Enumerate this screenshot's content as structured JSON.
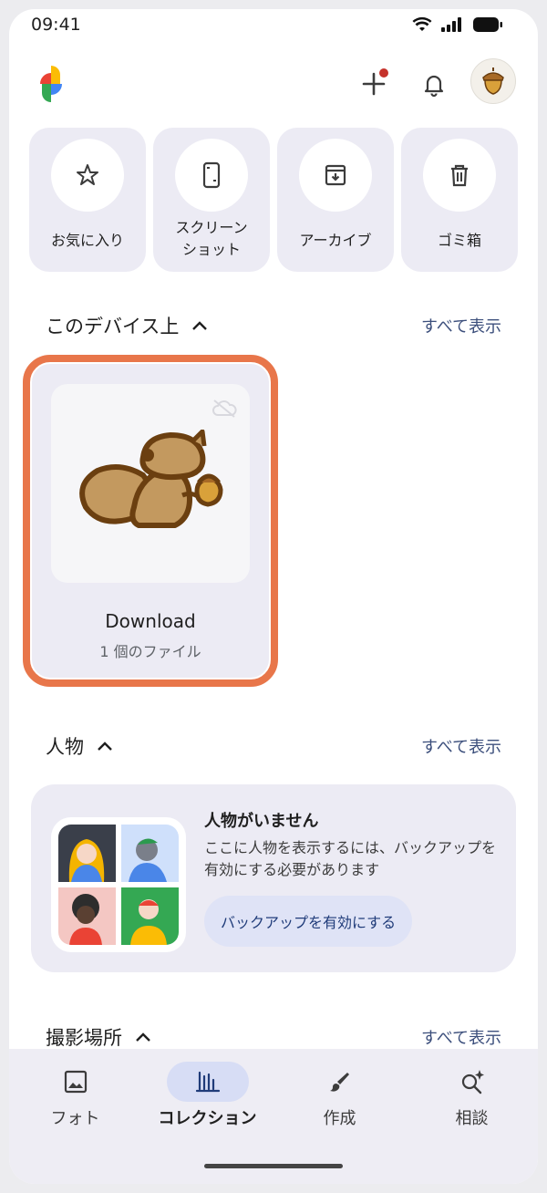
{
  "status_bar": {
    "time": "09:41"
  },
  "quick_access": [
    {
      "label": "お気に入り",
      "icon": "star-icon"
    },
    {
      "label": "スクリーン\nショット",
      "icon": "screenshot-icon"
    },
    {
      "label": "アーカイブ",
      "icon": "archive-icon"
    },
    {
      "label": "ゴミ箱",
      "icon": "trash-icon"
    }
  ],
  "device_section": {
    "title": "このデバイス上",
    "see_all": "すべて表示",
    "album": {
      "name": "Download",
      "count": "1 個のファイル"
    }
  },
  "people_section": {
    "title": "人物",
    "see_all": "すべて表示",
    "empty_title": "人物がいません",
    "empty_desc": "ここに人物を表示するには、バックアップを有効にする必要があります",
    "button": "バックアップを有効にする"
  },
  "places_section": {
    "title": "撮影場所",
    "see_all": "すべて表示"
  },
  "bottom_nav": [
    {
      "label": "フォト",
      "icon": "photo-icon",
      "active": false
    },
    {
      "label": "コレクション",
      "icon": "collections-icon",
      "active": true
    },
    {
      "label": "作成",
      "icon": "brush-icon",
      "active": false
    },
    {
      "label": "相談",
      "icon": "ask-sparkle-icon",
      "active": false
    }
  ],
  "colors": {
    "accent_outline": "#e8764a",
    "card_bg": "#ecebf4",
    "link": "#3c4f7c"
  }
}
